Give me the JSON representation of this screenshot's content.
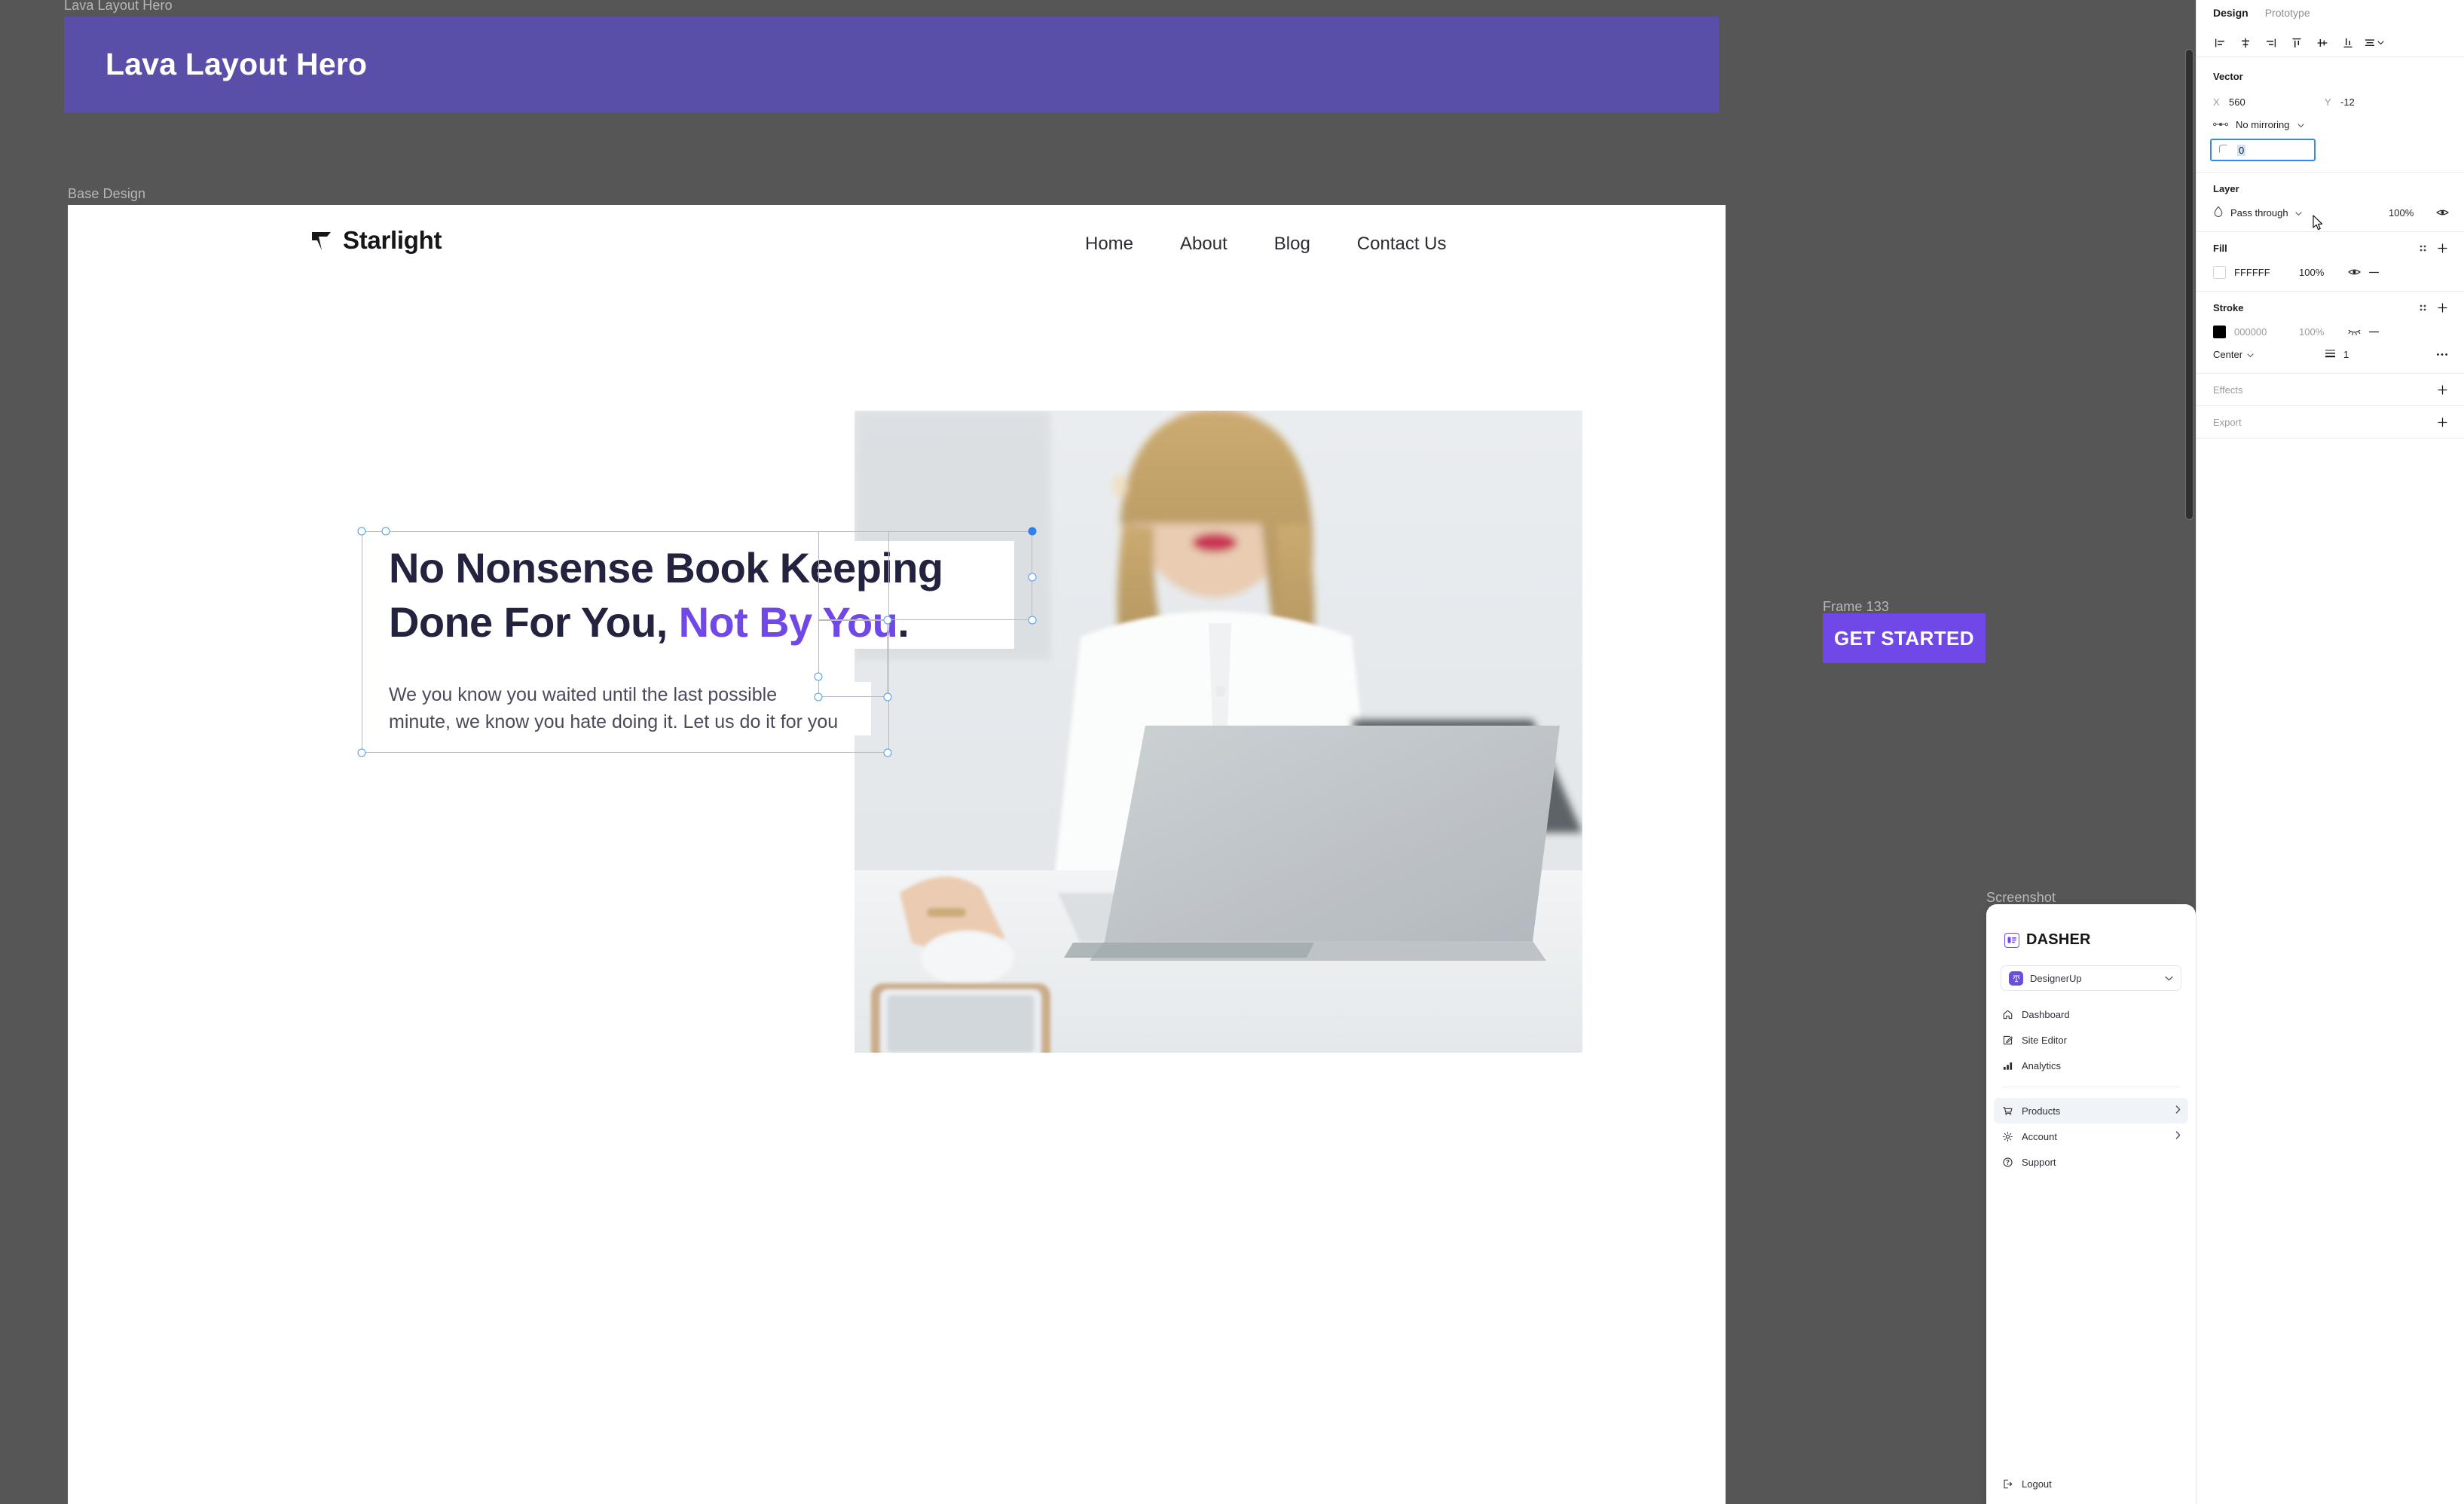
{
  "canvas": {
    "frames": [
      {
        "label": "Lava Layout Hero"
      },
      {
        "label": "Base Design"
      },
      {
        "label": "Frame 133"
      },
      {
        "label": "Screenshot"
      }
    ],
    "lava_banner": {
      "title": "Lava Layout Hero",
      "bg_color": "#5a4fa8"
    },
    "get_started": {
      "label": "GET STARTED",
      "bg_color": "#7048e8"
    }
  },
  "site": {
    "brand": "Starlight",
    "nav": [
      {
        "label": "Home"
      },
      {
        "label": "About"
      },
      {
        "label": "Blog"
      },
      {
        "label": "Contact Us"
      }
    ],
    "hero": {
      "heading_line1": "No Nonsense Book Keeping",
      "heading_line2_plain": "Done For You,",
      "heading_line2_accent": "Not By You",
      "heading_line2_dot": ".",
      "accent_color": "#7048e8",
      "subtext_line1": "We you know you waited until the last possible",
      "subtext_line2": "minute, we know you hate doing it. Let us do it for you"
    }
  },
  "dasher": {
    "wordmark": "DASHER",
    "workspace": {
      "name": "DesignerUp"
    },
    "nav_primary": [
      {
        "label": "Dashboard",
        "icon": "home-icon",
        "arrow": false
      },
      {
        "label": "Site Editor",
        "icon": "pencil-square-icon",
        "arrow": false
      },
      {
        "label": "Analytics",
        "icon": "bar-chart-icon",
        "arrow": false
      }
    ],
    "nav_secondary": [
      {
        "label": "Products",
        "icon": "cart-icon",
        "arrow": true,
        "active": true
      },
      {
        "label": "Account",
        "icon": "gear-icon",
        "arrow": true,
        "active": false
      },
      {
        "label": "Support",
        "icon": "question-circle-icon",
        "arrow": false,
        "active": false
      }
    ],
    "logout": {
      "label": "Logout",
      "icon": "logout-icon"
    }
  },
  "help": {
    "glyph": "?"
  },
  "inspector": {
    "tabs": [
      {
        "label": "Design",
        "active": true
      },
      {
        "label": "Prototype",
        "active": false
      }
    ],
    "align_buttons": [
      "align-left-icon",
      "align-horizontal-center-icon",
      "align-right-icon",
      "align-top-icon",
      "align-vertical-center-icon",
      "align-bottom-icon",
      "distribute-icon"
    ],
    "vector": {
      "title": "Vector",
      "x_label": "X",
      "x_value": "560",
      "y_label": "Y",
      "y_value": "-12",
      "mirroring": "No mirroring",
      "corner_radius": "0"
    },
    "layer": {
      "title": "Layer",
      "blend_mode": "Pass through",
      "opacity": "100%"
    },
    "fill": {
      "title": "Fill",
      "items": [
        {
          "hex": "FFFFFF",
          "opacity": "100%",
          "swatch": "#ffffff",
          "visible": true
        }
      ]
    },
    "stroke": {
      "title": "Stroke",
      "items": [
        {
          "hex": "000000",
          "opacity": "100%",
          "swatch": "#000000",
          "visible": false
        }
      ],
      "position": "Center",
      "weight": "1"
    },
    "effects": {
      "title": "Effects"
    },
    "export": {
      "title": "Export"
    }
  }
}
